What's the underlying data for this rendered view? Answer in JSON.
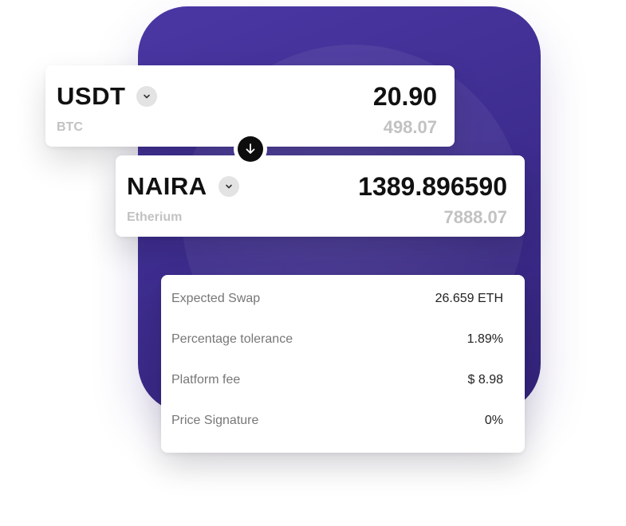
{
  "from": {
    "asset": "USDT",
    "amount": "20.90",
    "sub_label": "BTC",
    "sub_amount": "498.07"
  },
  "to": {
    "asset": "NAIRA",
    "amount": "1389.896590",
    "sub_label": "Etherium",
    "sub_amount": "7888.07"
  },
  "details": [
    {
      "label": "Expected Swap",
      "value": "26.659 ETH"
    },
    {
      "label": "Percentage tolerance",
      "value": "1.89%"
    },
    {
      "label": "Platform fee",
      "value": "$ 8.98"
    },
    {
      "label": "Price Signature",
      "value": "0%"
    }
  ],
  "icons": {
    "dropdown": "chevron-down-icon",
    "swap": "arrow-down-icon"
  },
  "colors": {
    "panel": "#4b37a3",
    "muted_text": "#c2c2c2",
    "label_text": "#777777"
  }
}
